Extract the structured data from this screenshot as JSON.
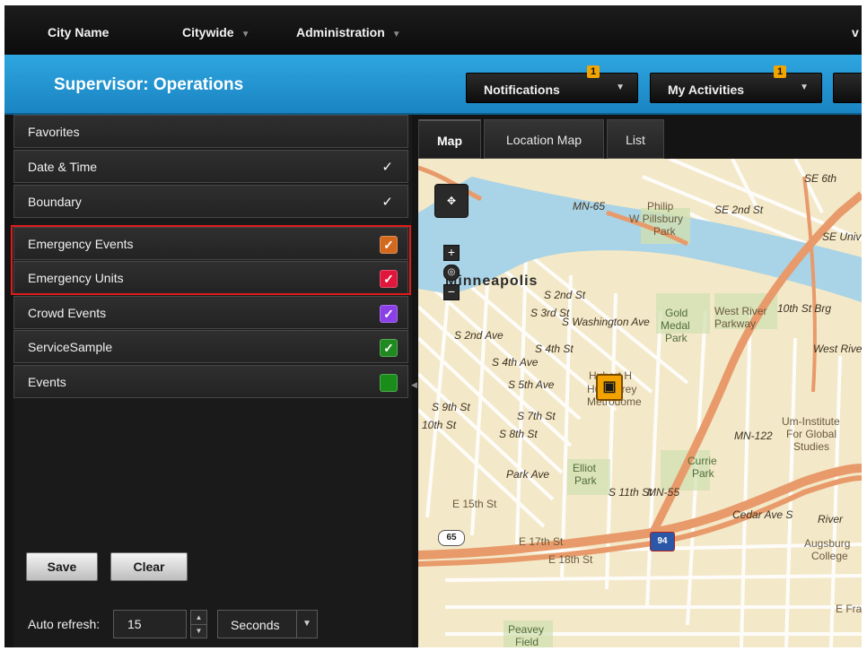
{
  "topnav": {
    "city_name": "City Name",
    "menus": [
      {
        "label": "Citywide"
      },
      {
        "label": "Administration"
      }
    ]
  },
  "header": {
    "title": "Supervisor: Operations",
    "notifications": {
      "label": "Notifications",
      "badge": "1"
    },
    "my_activities": {
      "label": "My Activities",
      "badge": "1"
    }
  },
  "filters": [
    {
      "label": "Favorites"
    },
    {
      "label": "Date & Time",
      "check": "✓"
    },
    {
      "label": "Boundary",
      "check": "✓"
    },
    {
      "label": "Emergency Events",
      "color": "#d2691e",
      "checked": true,
      "mark": "✓"
    },
    {
      "label": "Emergency Units",
      "color": "#e0163c",
      "checked": true,
      "mark": "✓"
    },
    {
      "label": "Crowd Events",
      "color": "#8b3fe6",
      "checked": true,
      "mark": "✓"
    },
    {
      "label": "ServiceSample",
      "color": "#1f8a1f",
      "checked": true,
      "mark": "✓"
    },
    {
      "label": "Events",
      "color": "#1a8c1a",
      "checked": false
    }
  ],
  "buttons": {
    "save": "Save",
    "clear": "Clear"
  },
  "auto_refresh": {
    "label": "Auto refresh:",
    "value": "15",
    "unit": "Seconds"
  },
  "tabs": [
    {
      "label": "Map",
      "active": true
    },
    {
      "label": "Location Map"
    },
    {
      "label": "List"
    }
  ],
  "map": {
    "city": "Minneapolis",
    "labels": {
      "mn65": "MN-65",
      "mn122": "MN-122",
      "mn55": "MN-55",
      "philip": "Philip",
      "pillsbury": "W Pillsbury",
      "park1": "Park",
      "gold": "Gold",
      "medal": "Medal",
      "park2": "Park",
      "westriver": "West River",
      "parkway": "Parkway",
      "s2nd": "S 2nd St",
      "s3rd": "S 3rd St",
      "swash": "S Washington Ave",
      "s4th": "S 4th St",
      "s4thave": "S 4th Ave",
      "s5thave": "S 5th Ave",
      "s7th": "S 7th St",
      "s8th": "S 8th St",
      "s9th": "S 9th St",
      "s10th": "10th St",
      "s2ndave": "S 2nd Ave",
      "hubert": "Hubert H",
      "humphrey": "Humphrey",
      "metrodome": "Metrodome",
      "elliot": "Elliot",
      "park3": "Park",
      "parkave": "Park Ave",
      "s11th": "S 11th St",
      "e15th": "E 15th St",
      "e17th": "E 17th St",
      "e18th": "E 18th St",
      "currie": "Currie",
      "park4": "Park",
      "cedar": "Cedar Ave S",
      "umi": "Um-Institute",
      "forglobal": "For Global",
      "studies": "Studies",
      "augsburg": "Augsburg",
      "college": "College",
      "peavey": "Peavey",
      "field": "Field",
      "river": "River",
      "se2nd": "SE 2nd St",
      "se6th": "SE 6th",
      "seuniv": "SE Univ",
      "tenthstbrg": "10th St Brg",
      "westriverpky": "West River Pky",
      "efra": "E Fra",
      "i94": "94",
      "r65": "65"
    }
  }
}
